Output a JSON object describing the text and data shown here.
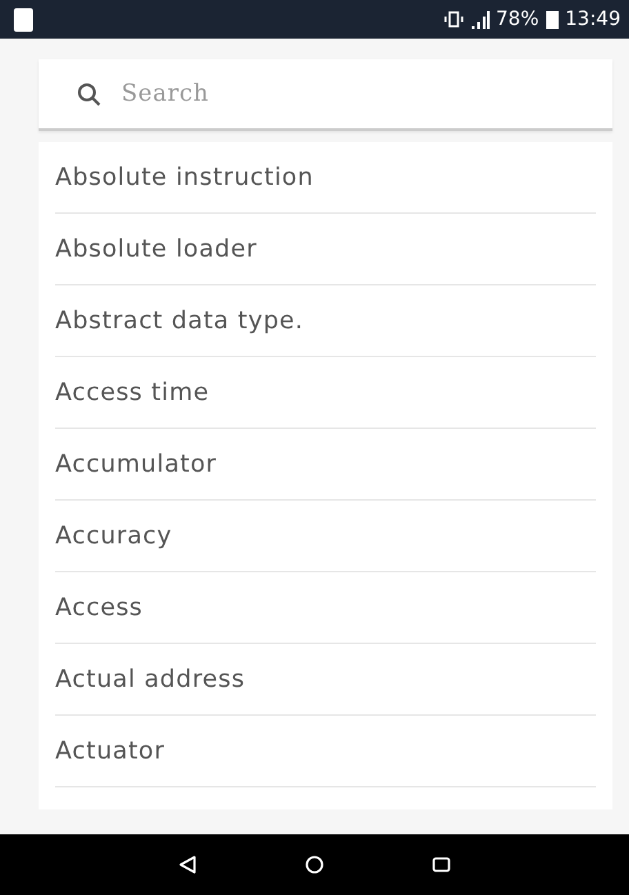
{
  "status_bar": {
    "battery": "78%",
    "time": "13:49"
  },
  "search": {
    "placeholder": "Search"
  },
  "items": [
    "Absolute instruction",
    "Absolute loader",
    "Abstract data type.",
    "Access time",
    "Accumulator",
    "Accuracy",
    "Access",
    "Actual address",
    "Actuator"
  ]
}
